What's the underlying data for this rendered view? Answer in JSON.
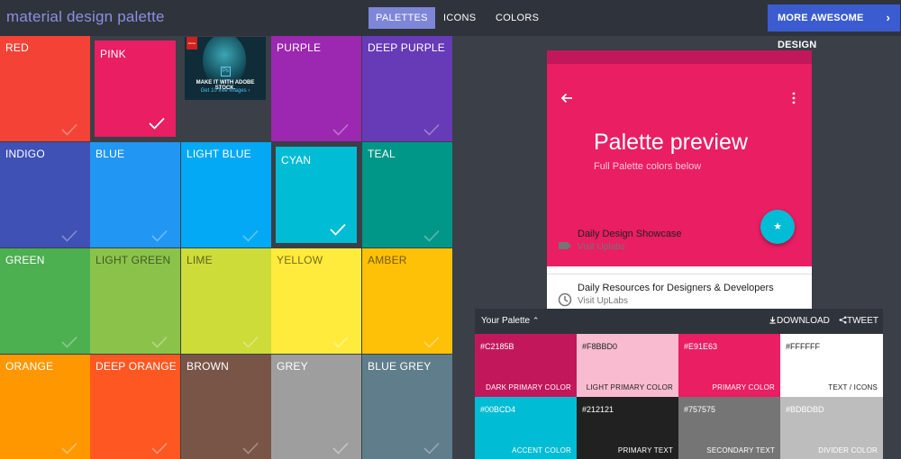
{
  "header": {
    "brand": "material design palette",
    "nav": [
      "PALETTES",
      "ICONS",
      "COLORS"
    ],
    "cta": "MORE AWESOME DESIGN",
    "cta_chevron": "›"
  },
  "tiles": [
    {
      "label": "RED",
      "color": "#f44336"
    },
    {
      "label": "PINK",
      "color": "#e91e63"
    },
    {
      "label": "PURPLE",
      "color": "#9c27b0"
    },
    {
      "label": "DEEP PURPLE",
      "color": "#673ab7"
    },
    {
      "label": "INDIGO",
      "color": "#3f51b5"
    },
    {
      "label": "BLUE",
      "color": "#2196f3"
    },
    {
      "label": "LIGHT BLUE",
      "color": "#03a9f4"
    },
    {
      "label": "CYAN",
      "color": "#00bcd4"
    },
    {
      "label": "TEAL",
      "color": "#009688"
    },
    {
      "label": "GREEN",
      "color": "#4caf50"
    },
    {
      "label": "LIGHT GREEN",
      "color": "#8bc34a"
    },
    {
      "label": "LIME",
      "color": "#cddc39"
    },
    {
      "label": "YELLOW",
      "color": "#ffeb3b"
    },
    {
      "label": "AMBER",
      "color": "#ffc107"
    },
    {
      "label": "ORANGE",
      "color": "#ff9800"
    },
    {
      "label": "DEEP ORANGE",
      "color": "#ff5722"
    },
    {
      "label": "BROWN",
      "color": "#795548"
    },
    {
      "label": "GREY",
      "color": "#9e9e9e"
    },
    {
      "label": "BLUE GREY",
      "color": "#607d8b"
    }
  ],
  "ad": {
    "brand": "Adobe",
    "product": "Ps",
    "line1": "MAKE IT WITH ADOBE STOCK.",
    "line2": "Get 10 free images ›"
  },
  "preview": {
    "title": "Palette preview",
    "subtitle": "Full Palette colors below",
    "fab_glyph": "★",
    "items": [
      {
        "title": "Daily Design Showcase",
        "subtitle": "Visit Uplabs"
      },
      {
        "title": "Daily Resources for Designers & Developers",
        "subtitle": "Visit UpLabs"
      }
    ]
  },
  "palette_panel": {
    "title": "Your Palette",
    "title_caret": "⌃",
    "download": "DOWNLOAD",
    "tweet": "TWEET",
    "swatches": [
      {
        "hex": "#C2185B",
        "name": "DARK PRIMARY COLOR",
        "color": "#c2185b",
        "dark": false
      },
      {
        "hex": "#F8BBD0",
        "name": "LIGHT PRIMARY COLOR",
        "color": "#f8bbd0",
        "dark": true
      },
      {
        "hex": "#E91E63",
        "name": "PRIMARY COLOR",
        "color": "#e91e63",
        "dark": false
      },
      {
        "hex": "#FFFFFF",
        "name": "TEXT / ICONS",
        "color": "#ffffff",
        "dark": true
      },
      {
        "hex": "#00BCD4",
        "name": "ACCENT COLOR",
        "color": "#00bcd4",
        "dark": false
      },
      {
        "hex": "#212121",
        "name": "PRIMARY TEXT",
        "color": "#212121",
        "dark": false
      },
      {
        "hex": "#757575",
        "name": "SECONDARY TEXT",
        "color": "#757575",
        "dark": false
      },
      {
        "hex": "#BDBDBD",
        "name": "DIVIDER COLOR",
        "color": "#bdbdbd",
        "dark": false
      }
    ]
  }
}
